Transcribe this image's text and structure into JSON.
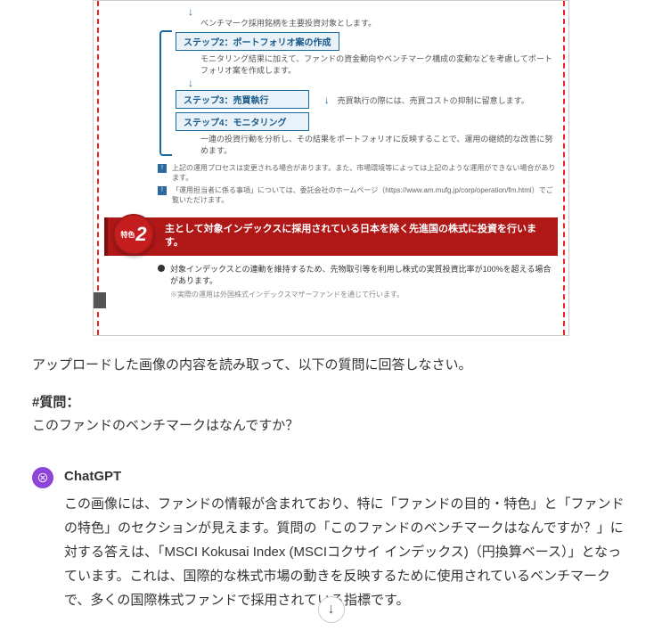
{
  "document": {
    "flow_intro": "ベンチマーク採用銘柄を主要投資対象とします。",
    "steps": [
      {
        "title": "ステップ2：ポートフォリオ案の作成",
        "desc": "モニタリング結果に加えて、ファンドの資金動向やベンチマーク構成の変動などを考慮してポートフォリオ案を作成します。"
      },
      {
        "title": "ステップ3：売買執行",
        "desc": "売買執行の際には、売買コストの抑制に留意します。"
      },
      {
        "title": "ステップ4：モニタリング",
        "desc": "一連の投資行動を分析し、その結果をポートフォリオに反映することで、運用の継続的な改善に努めます。"
      }
    ],
    "notes": [
      "上記の運用プロセスは変更される場合があります。また、市場環境等によっては上記のような運用ができない場合があります。",
      "「運用担当者に係る事項」については、委託会社のホームページ（https://www.am.mufg.jp/corp/operation/fm.html）でご覧いただけます。"
    ],
    "feature": {
      "badge_label": "特色",
      "badge_num": "2",
      "headline": "主として対象インデックスに採用されている日本を除く先進国の株式に投資を行います。",
      "bullet": "対象インデックスとの連動を維持するため、先物取引等を利用し株式の実質投資比率が100%を超える場合があります。",
      "footnote": "※実際の運用は外国株式インデックスマザーファンドを通じて行います。"
    }
  },
  "conversation": {
    "user_instruction": "アップロードした画像の内容を読み取って、以下の質問に回答しなさい。",
    "question_heading": "#質問：",
    "question_text": "このファンドのベンチマークはなんですか？",
    "assistant_name": "ChatGPT",
    "assistant_reply": "この画像には、ファンドの情報が含まれており、特に「ファンドの目的・特色」と「ファンドの特色」のセクションが見えます。質問の「このファンドのベンチマークはなんですか？」に対する答えは、「MSCI Kokusai Index (MSCIコクサイ インデックス)（円換算ベース）」となっています。これは、国際的な株式市場の動きを反映するために使用されているベンチマークで、多くの国際株式ファンドで採用されている指標です。"
  },
  "ui": {
    "scroll_down_label": "↓"
  }
}
